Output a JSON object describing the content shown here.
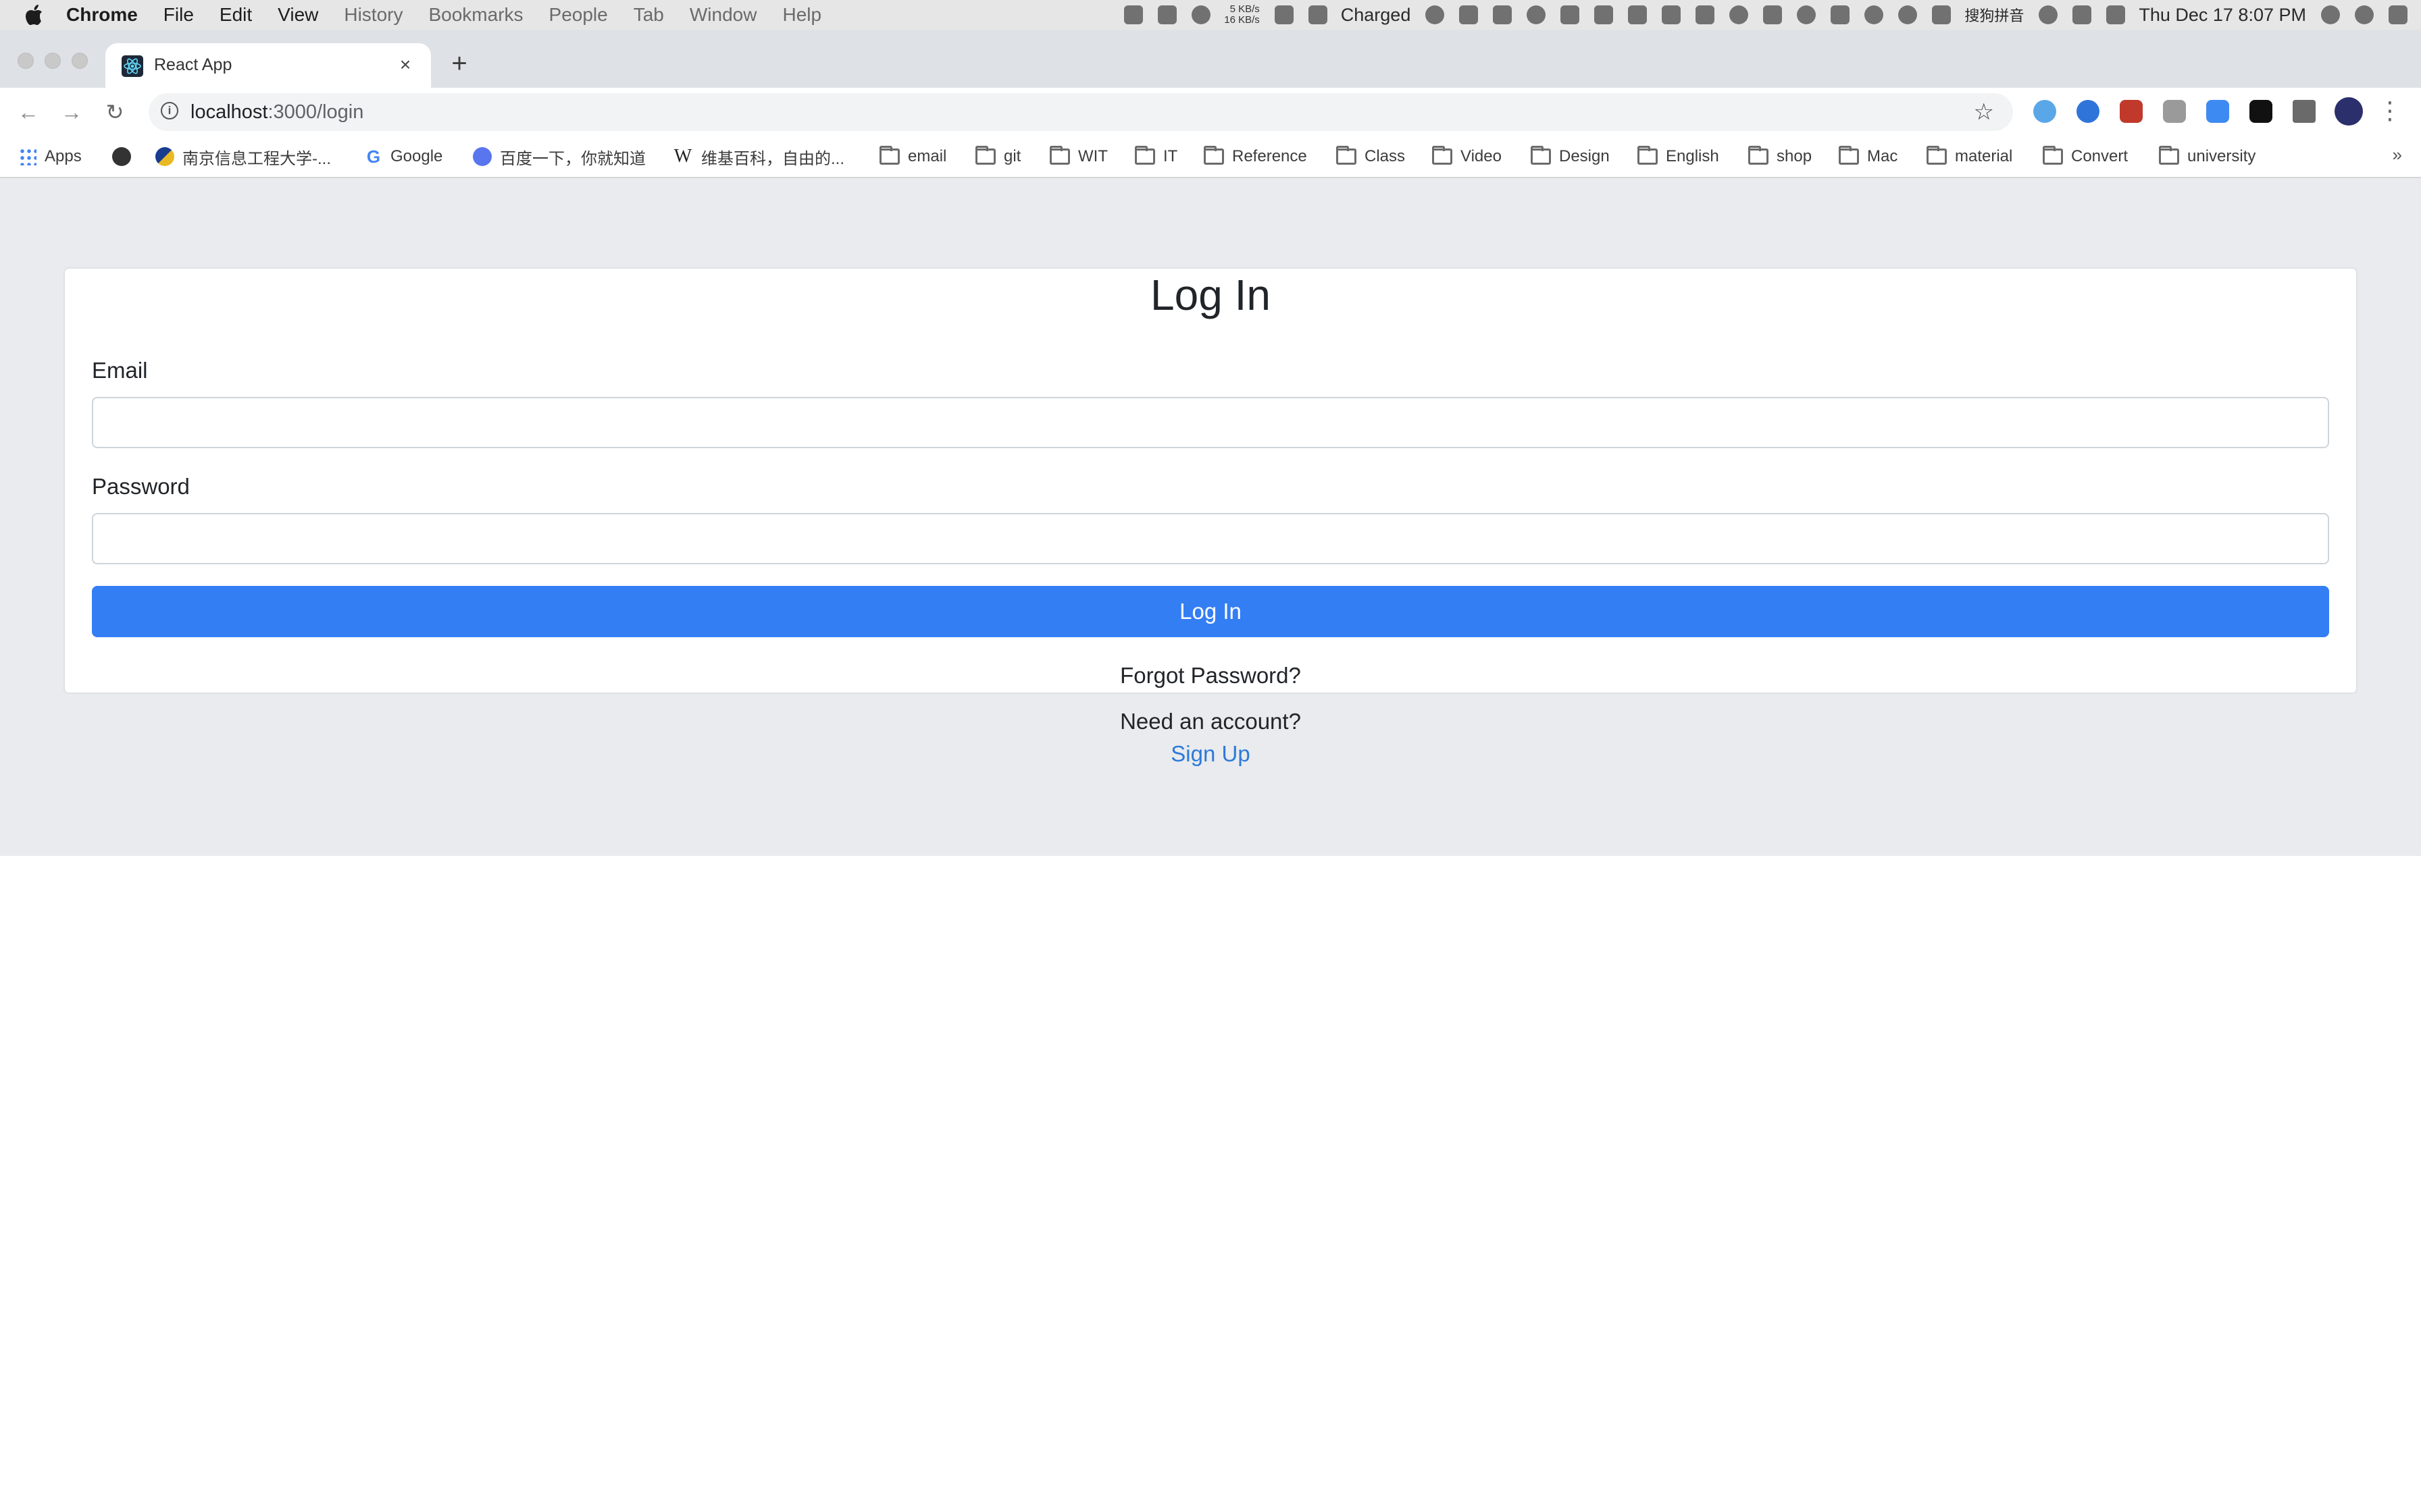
{
  "menubar": {
    "app": "Chrome",
    "items": [
      "File",
      "Edit",
      "View",
      "History",
      "Bookmarks",
      "People",
      "Tab",
      "Window",
      "Help"
    ],
    "net_up": "5 KB/s",
    "net_down": "16 KB/s",
    "battery_status": "Charged",
    "ime": "搜狗拼音",
    "clock": "Thu Dec 17  8:07 PM"
  },
  "tab": {
    "title": "React App",
    "close_glyph": "×",
    "new_tab_glyph": "+"
  },
  "toolbar": {
    "back_glyph": "←",
    "forward_glyph": "→",
    "reload_glyph": "↻",
    "url_host": "localhost",
    "url_path": ":3000/login",
    "star_glyph": "☆",
    "menu_glyph": "⋮"
  },
  "bookmarks": {
    "apps": "Apps",
    "items": [
      "南京信息工程大学-...",
      "Google",
      "百度一下，你就知道",
      "维基百科，自由的...",
      "email",
      "git",
      "WIT",
      "IT",
      "Reference",
      "Class",
      "Video",
      "Design",
      "English",
      "shop",
      "Mac",
      "material",
      "Convert",
      "university"
    ],
    "more": "»"
  },
  "form": {
    "heading": "Log In",
    "email_label": "Email",
    "email_value": "",
    "password_label": "Password",
    "password_value": "",
    "submit_label": "Log In",
    "forgot_password": "Forgot Password?",
    "need_account": "Need an account?",
    "signup_link": "Sign Up"
  },
  "colors": {
    "primary": "#347ef4",
    "link": "#2e7ad9",
    "page_bg": "#e9ebee"
  }
}
